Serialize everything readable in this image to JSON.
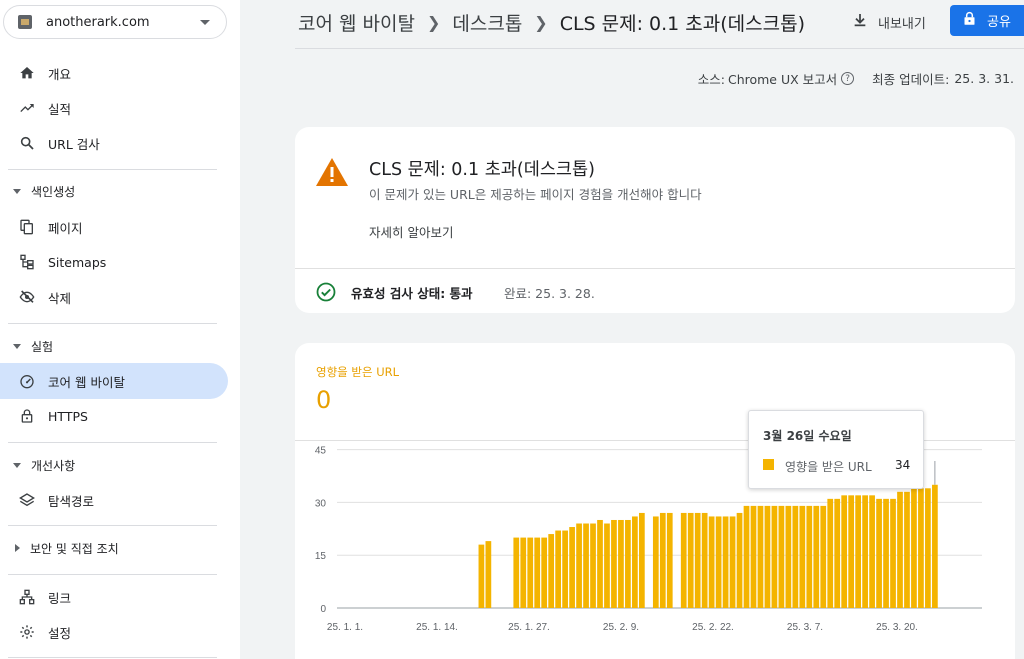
{
  "sidebar": {
    "property": "anotherark.com",
    "top_items": [
      {
        "label": "개요",
        "icon": "home-icon"
      },
      {
        "label": "실적",
        "icon": "trending-up-icon"
      },
      {
        "label": "URL 검사",
        "icon": "search-icon"
      }
    ],
    "sections": [
      {
        "label": "색인생성",
        "items": [
          {
            "label": "페이지",
            "icon": "pages-icon"
          },
          {
            "label": "Sitemaps",
            "icon": "sitemap-icon"
          },
          {
            "label": "삭제",
            "icon": "eye-off-icon"
          }
        ]
      },
      {
        "label": "실험",
        "items": [
          {
            "label": "코어 웹 바이탈",
            "icon": "speed-gauge-icon",
            "active": true
          },
          {
            "label": "HTTPS",
            "icon": "lock-icon"
          }
        ]
      },
      {
        "label": "개선사항",
        "items": [
          {
            "label": "탐색경로",
            "icon": "layers-icon"
          }
        ]
      },
      {
        "label": "보안 및 직접 조치",
        "items": []
      }
    ],
    "bottom_items": [
      {
        "label": "링크",
        "icon": "link-tree-icon"
      },
      {
        "label": "설정",
        "icon": "gear-icon"
      }
    ]
  },
  "header": {
    "breadcrumb": [
      "코어 웹 바이탈",
      "데스크톱",
      "CLS 문제: 0.1 초과(데스크톱)"
    ],
    "export_label": "내보내기",
    "share_label": "공유"
  },
  "source": {
    "source_label": "소스:",
    "source_value": "Chrome UX 보고서",
    "updated_label": "최종 업데이트:",
    "updated_value": "25. 3. 31."
  },
  "issue": {
    "title": "CLS 문제: 0.1 초과(데스크톱)",
    "description": "이 문제가 있는 URL은 제공하는 페이지 경험을 개선해야 합니다",
    "learn_more": "자세히 알아보기",
    "validation_status": "유효성 검사 상태: 통과",
    "validation_done": "완료: 25. 3. 28."
  },
  "metric": {
    "label": "영향을 받은 URL",
    "value": "0"
  },
  "tooltip": {
    "date": "3월 26일 수요일",
    "series": "영향을 받은 URL",
    "value": "34"
  },
  "colors": {
    "bar": "#f4b400",
    "accent": "#1a73e8",
    "warning": "#e37400",
    "pass": "#188038"
  },
  "chart_data": {
    "type": "bar",
    "x_ticks": [
      "25. 1. 1.",
      "25. 1. 14.",
      "25. 1. 27.",
      "25. 2. 9.",
      "25. 2. 22.",
      "25. 3. 7.",
      "25. 3. 20."
    ],
    "y_ticks": [
      0,
      15,
      30,
      45
    ],
    "ylim": [
      0,
      48
    ],
    "grid": true,
    "series": [
      {
        "name": "영향을 받은 URL",
        "values": [
          null,
          null,
          null,
          null,
          null,
          null,
          null,
          null,
          null,
          null,
          null,
          null,
          null,
          null,
          null,
          null,
          null,
          null,
          null,
          null,
          18,
          19,
          null,
          null,
          null,
          20,
          20,
          20,
          20,
          20,
          21,
          22,
          22,
          23,
          24,
          24,
          24,
          25,
          24,
          25,
          25,
          25,
          26,
          27,
          null,
          26,
          27,
          27,
          null,
          27,
          27,
          27,
          27,
          26,
          26,
          26,
          26,
          27,
          29,
          29,
          29,
          29,
          29,
          29,
          29,
          29,
          29,
          29,
          29,
          29,
          31,
          31,
          32,
          32,
          32,
          32,
          32,
          31,
          31,
          31,
          33,
          33,
          34,
          34,
          34,
          35
        ]
      }
    ]
  }
}
